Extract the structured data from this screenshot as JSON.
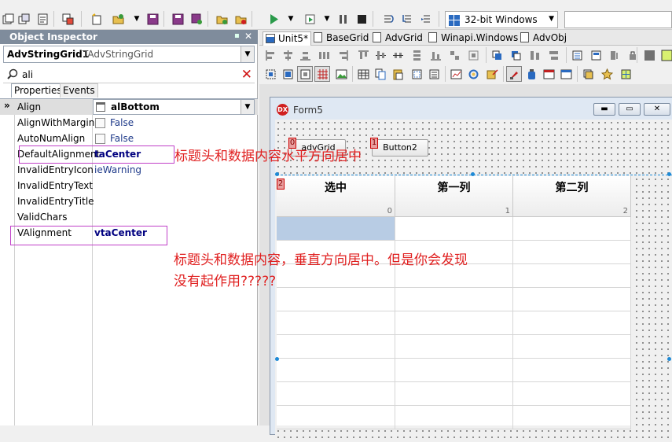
{
  "toolbar": {
    "platform_label": "32-bit Windows"
  },
  "object_inspector": {
    "title": "Object Inspector",
    "component_name": "AdvStringGrid1",
    "component_type": "TAdvStringGrid",
    "search_text": "ali",
    "tabs": [
      "Properties",
      "Events"
    ],
    "properties": [
      {
        "name": "Align",
        "value": "alBottom"
      },
      {
        "name": "AlignWithMargins",
        "value": "False"
      },
      {
        "name": "AutoNumAlign",
        "value": "False"
      },
      {
        "name": "DefaultAlignment",
        "value": "taCenter"
      },
      {
        "name": "InvalidEntryIcon",
        "value": "ieWarning"
      },
      {
        "name": "InvalidEntryText",
        "value": ""
      },
      {
        "name": "InvalidEntryTitle",
        "value": ""
      },
      {
        "name": "ValidChars",
        "value": ""
      },
      {
        "name": "VAlignment",
        "value": "vtaCenter"
      }
    ]
  },
  "editor_tabs": [
    "Unit5*",
    "BaseGrid",
    "AdvGrid",
    "Winapi.Windows",
    "AdvObj"
  ],
  "form": {
    "title": "Form5",
    "logo_text": "DX",
    "button1_label": "advGrid",
    "button2_label": "Button2",
    "tag0": "0",
    "tag1": "1",
    "tag2": "2",
    "grid": {
      "headers": [
        "选中",
        "第一列",
        "第二列"
      ],
      "header_indices": [
        "0",
        "1",
        "2"
      ]
    }
  },
  "annotations": {
    "horizontal_note": "标题头和数据内容水平方向居中",
    "vertical_note_line1": "标题头和数据内容，垂直方向居中。但是你会发现",
    "vertical_note_line2": "没有起作用?????"
  },
  "colors": {
    "annotation": "#e02020",
    "highlight_box": "#c040c8",
    "selected_cell": "#b8cce4"
  }
}
